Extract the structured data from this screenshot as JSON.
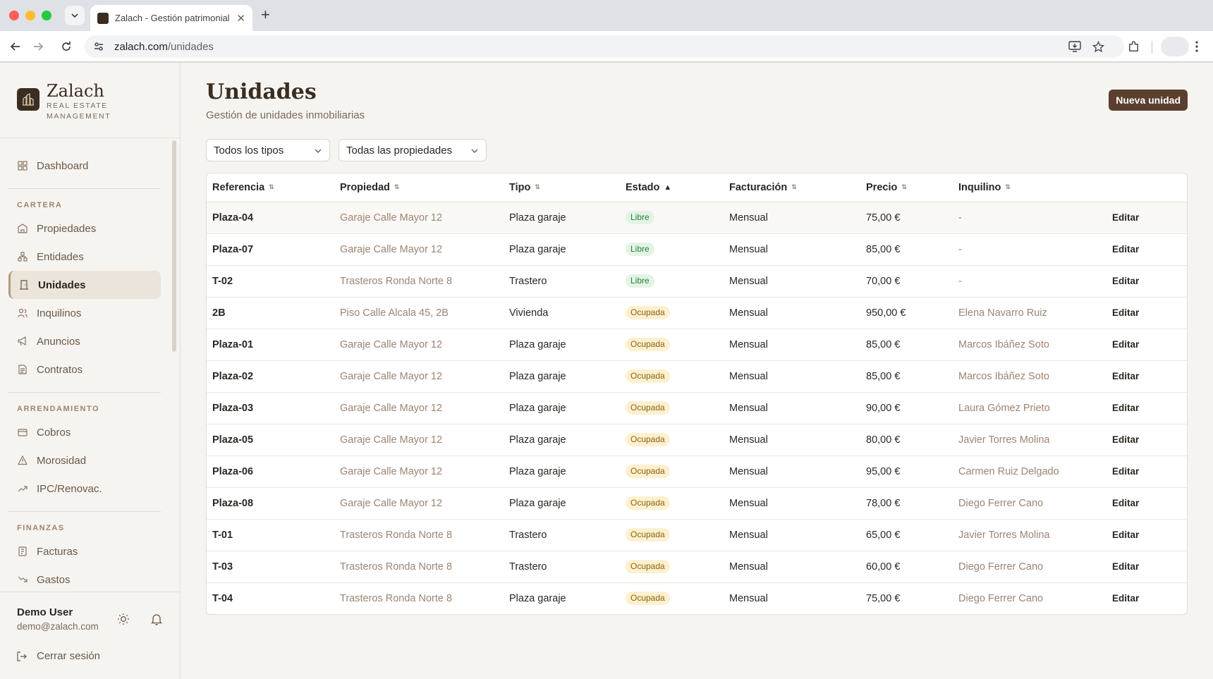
{
  "browser": {
    "tab_title": "Zalach - Gestión patrimonial i",
    "url_host": "zalach.com",
    "url_path": "/unidades"
  },
  "brand": {
    "name": "Zalach",
    "subtitle": "REAL ESTATE MANAGEMENT"
  },
  "nav": {
    "dashboard": "Dashboard",
    "section_cartera": "CARTERA",
    "propiedades": "Propiedades",
    "entidades": "Entidades",
    "unidades": "Unidades",
    "inquilinos": "Inquilinos",
    "anuncios": "Anuncios",
    "contratos": "Contratos",
    "section_arrendamiento": "ARRENDAMIENTO",
    "cobros": "Cobros",
    "morosidad": "Morosidad",
    "ipc": "IPC/Renovac.",
    "section_finanzas": "FINANZAS",
    "facturas": "Facturas",
    "gastos": "Gastos"
  },
  "user": {
    "name": "Demo User",
    "email": "demo@zalach.com",
    "logout": "Cerrar sesión"
  },
  "page": {
    "title": "Unidades",
    "subtitle": "Gestión de unidades inmobiliarias",
    "new_button": "Nueva unidad"
  },
  "filters": {
    "type": "Todos los tipos",
    "property": "Todas las propiedades"
  },
  "table": {
    "headers": {
      "ref": "Referencia",
      "prop": "Propiedad",
      "type": "Tipo",
      "status": "Estado",
      "billing": "Facturación",
      "price": "Precio",
      "tenant": "Inquilino"
    },
    "edit_label": "Editar",
    "rows": [
      {
        "ref": "Plaza-04",
        "prop": "Garaje Calle Mayor 12",
        "type": "Plaza garaje",
        "status": "Libre",
        "billing": "Mensual",
        "price": "75,00 €",
        "tenant": "-"
      },
      {
        "ref": "Plaza-07",
        "prop": "Garaje Calle Mayor 12",
        "type": "Plaza garaje",
        "status": "Libre",
        "billing": "Mensual",
        "price": "85,00 €",
        "tenant": "-"
      },
      {
        "ref": "T-02",
        "prop": "Trasteros Ronda Norte 8",
        "type": "Trastero",
        "status": "Libre",
        "billing": "Mensual",
        "price": "70,00 €",
        "tenant": "-"
      },
      {
        "ref": "2B",
        "prop": "Piso Calle Alcala 45, 2B",
        "type": "Vivienda",
        "status": "Ocupada",
        "billing": "Mensual",
        "price": "950,00 €",
        "tenant": "Elena Navarro Ruiz"
      },
      {
        "ref": "Plaza-01",
        "prop": "Garaje Calle Mayor 12",
        "type": "Plaza garaje",
        "status": "Ocupada",
        "billing": "Mensual",
        "price": "85,00 €",
        "tenant": "Marcos Ibáñez Soto"
      },
      {
        "ref": "Plaza-02",
        "prop": "Garaje Calle Mayor 12",
        "type": "Plaza garaje",
        "status": "Ocupada",
        "billing": "Mensual",
        "price": "85,00 €",
        "tenant": "Marcos Ibáñez Soto"
      },
      {
        "ref": "Plaza-03",
        "prop": "Garaje Calle Mayor 12",
        "type": "Plaza garaje",
        "status": "Ocupada",
        "billing": "Mensual",
        "price": "90,00 €",
        "tenant": "Laura Gómez Prieto"
      },
      {
        "ref": "Plaza-05",
        "prop": "Garaje Calle Mayor 12",
        "type": "Plaza garaje",
        "status": "Ocupada",
        "billing": "Mensual",
        "price": "80,00 €",
        "tenant": "Javier Torres Molina"
      },
      {
        "ref": "Plaza-06",
        "prop": "Garaje Calle Mayor 12",
        "type": "Plaza garaje",
        "status": "Ocupada",
        "billing": "Mensual",
        "price": "95,00 €",
        "tenant": "Carmen Ruiz Delgado"
      },
      {
        "ref": "Plaza-08",
        "prop": "Garaje Calle Mayor 12",
        "type": "Plaza garaje",
        "status": "Ocupada",
        "billing": "Mensual",
        "price": "78,00 €",
        "tenant": "Diego Ferrer Cano"
      },
      {
        "ref": "T-01",
        "prop": "Trasteros Ronda Norte 8",
        "type": "Trastero",
        "status": "Ocupada",
        "billing": "Mensual",
        "price": "65,00 €",
        "tenant": "Javier Torres Molina"
      },
      {
        "ref": "T-03",
        "prop": "Trasteros Ronda Norte 8",
        "type": "Trastero",
        "status": "Ocupada",
        "billing": "Mensual",
        "price": "60,00 €",
        "tenant": "Diego Ferrer Cano"
      },
      {
        "ref": "T-04",
        "prop": "Trasteros Ronda Norte 8",
        "type": "Plaza garaje",
        "status": "Ocupada",
        "billing": "Mensual",
        "price": "75,00 €",
        "tenant": "Diego Ferrer Cano"
      }
    ]
  },
  "colors": {
    "brand_dark": "#3a2d22",
    "primary_button": "#5a3e2e",
    "badge_libre_bg": "#e3f4e5",
    "badge_ocupada_bg": "#fdf0cf"
  }
}
